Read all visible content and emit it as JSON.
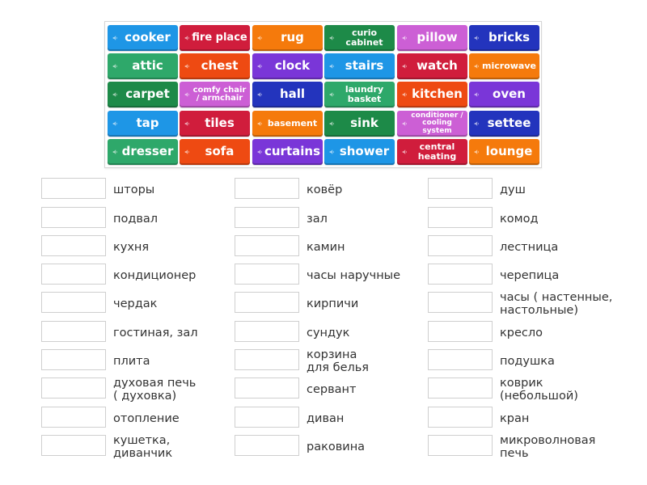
{
  "tiles": [
    {
      "label": "cooker",
      "color": "#1e96e6",
      "size": "big"
    },
    {
      "label": "fire place",
      "color": "#d01d3c",
      "size": "mid"
    },
    {
      "label": "rug",
      "color": "#f57a0c",
      "size": "big"
    },
    {
      "label": "curio cabinet",
      "color": "#1d8a48",
      "size": "small"
    },
    {
      "label": "pillow",
      "color": "#cc5fd5",
      "size": "big"
    },
    {
      "label": "bricks",
      "color": "#2334bd",
      "size": "big"
    },
    {
      "label": "attic",
      "color": "#2ea86a",
      "size": "big"
    },
    {
      "label": "chest",
      "color": "#ee4a12",
      "size": "big"
    },
    {
      "label": "clock",
      "color": "#7a36d8",
      "size": "big"
    },
    {
      "label": "stairs",
      "color": "#1e96e6",
      "size": "big"
    },
    {
      "label": "watch",
      "color": "#d01d3c",
      "size": "big"
    },
    {
      "label": "microwave",
      "color": "#f57a0c",
      "size": "small"
    },
    {
      "label": "carpet",
      "color": "#1d8a48",
      "size": "big"
    },
    {
      "label": "comfy chair / armchair",
      "color": "#cc5fd5",
      "size": "tiny"
    },
    {
      "label": "hall",
      "color": "#2334bd",
      "size": "big"
    },
    {
      "label": "laundry basket",
      "color": "#2ea86a",
      "size": "small"
    },
    {
      "label": "kitchen",
      "color": "#ee4a12",
      "size": "big"
    },
    {
      "label": "oven",
      "color": "#7a36d8",
      "size": "big"
    },
    {
      "label": "tap",
      "color": "#1e96e6",
      "size": "big"
    },
    {
      "label": "tiles",
      "color": "#d01d3c",
      "size": "big"
    },
    {
      "label": "basement",
      "color": "#f57a0c",
      "size": "small"
    },
    {
      "label": "sink",
      "color": "#1d8a48",
      "size": "big"
    },
    {
      "label": "conditioner / cooling system",
      "color": "#cc5fd5",
      "size": "xtiny"
    },
    {
      "label": "settee",
      "color": "#2334bd",
      "size": "big"
    },
    {
      "label": "dresser",
      "color": "#2ea86a",
      "size": "big"
    },
    {
      "label": "sofa",
      "color": "#ee4a12",
      "size": "big"
    },
    {
      "label": "curtains",
      "color": "#7a36d8",
      "size": "big"
    },
    {
      "label": "shower",
      "color": "#1e96e6",
      "size": "big"
    },
    {
      "label": "central heating",
      "color": "#d01d3c",
      "size": "small"
    },
    {
      "label": "lounge",
      "color": "#f57a0c",
      "size": "big"
    }
  ],
  "targets": {
    "col1": [
      "шторы",
      "подвал",
      "кухня",
      "кондиционер",
      "чердак",
      "гостиная, зал",
      "плита",
      "духовая печь\n( духовка)",
      "отопление",
      "кушетка,\nдиванчик"
    ],
    "col2": [
      "ковёр",
      "зал",
      "камин",
      "часы наручные",
      "кирпичи",
      "сундук",
      "корзина\nдля белья",
      "сервант",
      "диван",
      "раковина"
    ],
    "col3": [
      "душ",
      "комод",
      "лестница",
      "черепица",
      "часы ( настенные,\nнастольные)",
      "кресло",
      "подушка",
      "коврик\n(небольшой)",
      "кран",
      "микроволновая\nпечь"
    ]
  }
}
